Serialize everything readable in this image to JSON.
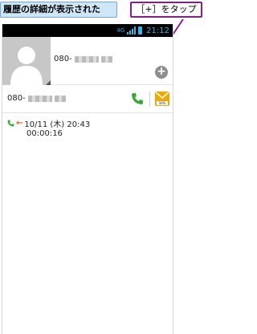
{
  "annotation": {
    "caption": "履歴の詳細が表示された",
    "callout": "［+］をタップ"
  },
  "statusbar": {
    "network": "4G",
    "time": "21:12"
  },
  "contact": {
    "number_prefix": "080-",
    "add_icon": "plus-circle-icon"
  },
  "number_row": {
    "number_prefix": "080-",
    "call_icon": "phone-icon",
    "message_icon": "message-icon",
    "message_label": "SMS"
  },
  "history": {
    "datetime": "10/11 (木) 20:43",
    "duration": "00:00:16",
    "call_type_icon": "outgoing-call-icon"
  },
  "colors": {
    "accent": "#33b5e5",
    "call_green": "#3aa83a",
    "outgoing_orange": "#e8631a",
    "callout_border": "#8a1d8a",
    "caption_bg": "#cfe6f7"
  }
}
